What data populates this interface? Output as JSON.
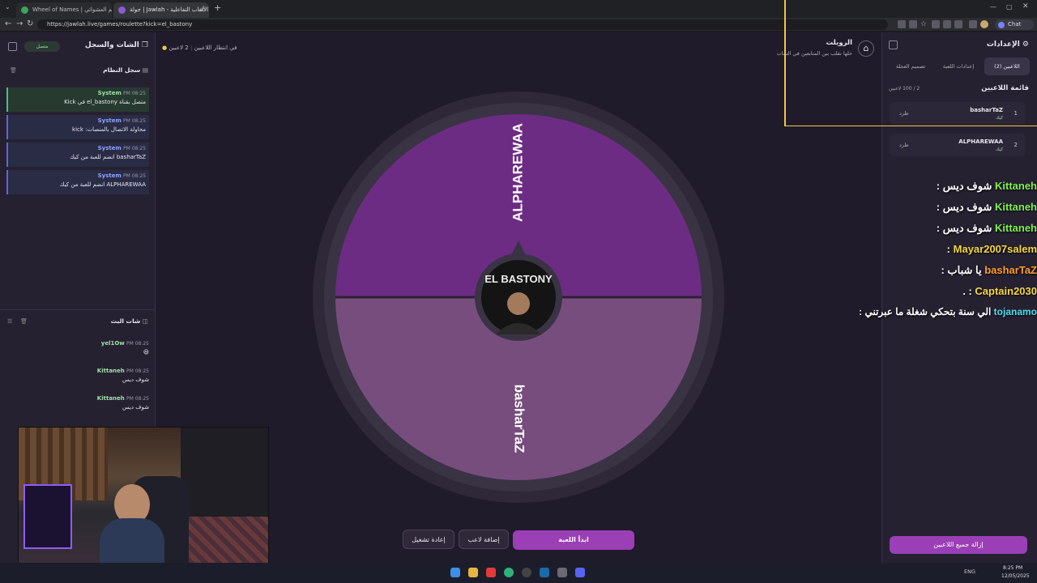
{
  "browser": {
    "tabs": [
      {
        "title": "Wheel of Names | الاسم العشوائي ..."
      },
      {
        "title": "جولة | Jawlah - منصة الألعاب التفاعلية"
      }
    ],
    "url": "https://jawlah.live/games/roulette?kick=el_bastony",
    "chat_button": "Chat"
  },
  "left_panel": {
    "title": "الشات والسجل",
    "status_badge": "متصل",
    "system_log": {
      "title": "سجل النظام",
      "entries": [
        {
          "sender": "System",
          "time": "PM 08:25",
          "message": "متصل بقناة el_bastony في Kick"
        },
        {
          "sender": "System",
          "time": "PM 08:25",
          "message": "محاولة الاتصال بالمنصات: kick"
        },
        {
          "sender": "System",
          "time": "PM 08:25",
          "message": "basharTaZ انضم للعبة من كيك"
        },
        {
          "sender": "System",
          "time": "PM 08:25",
          "message": "ALPHAREWAA انضم للعبة من كيك"
        }
      ]
    },
    "live_chat": {
      "title": "شات البث",
      "messages": [
        {
          "user": "yel1Ow",
          "time": "PM 08:25",
          "message": "😃"
        },
        {
          "user": "Kittaneh",
          "time": "PM 08:25",
          "message": "شوف ديس"
        },
        {
          "user": "Kittaneh",
          "time": "PM 08:25",
          "message": "شوف ديس"
        }
      ]
    }
  },
  "center": {
    "players_count": "2 لاعبين",
    "status": "في انتظار اللاعبين",
    "wheel": {
      "segments": [
        {
          "label": "ALPHAREWAA",
          "color": "#6d2c83"
        },
        {
          "label": "basharTaZ",
          "color": "#774d7e"
        }
      ],
      "center_text": "EL BASTONY"
    },
    "buttons": {
      "start": "ابدأ اللعبة",
      "add_player": "إضافة لاعب",
      "restart": "إعادة تشغيل"
    }
  },
  "game_title": {
    "title": "الرويلت",
    "subtitle": "خلها تقلب بين المتابعين في الشات"
  },
  "right_panel": {
    "title": "الإعدادات",
    "tabs": [
      "اللاعبين (2)",
      "إعدادات اللعبة",
      "تصميم العجلة"
    ],
    "players_header": "قائمة اللاعبين",
    "players_count": "2 / 100 لاعبين",
    "players": [
      {
        "rank": "1",
        "name": "basharTaZ",
        "platform": "كيك",
        "action": "طرد"
      },
      {
        "rank": "2",
        "name": "ALPHAREWAA",
        "platform": "كيك",
        "action": "طرد"
      }
    ],
    "remove_all": "إزالة جميع اللاعبين"
  },
  "stream_chat_overlay": [
    {
      "user": "Kittaneh",
      "message": "شوف ديس :",
      "color": "#7cf24a"
    },
    {
      "user": "Kittaneh",
      "message": "شوف ديس :",
      "color": "#7cf24a"
    },
    {
      "user": "Kittaneh",
      "message": "شوف ديس :",
      "color": "#7cf24a"
    },
    {
      "user": "Mayar2007salem",
      "message": ":",
      "color": "#f5d73b"
    },
    {
      "user": "basharTaZ",
      "message": "يا شباب :",
      "color": "#ff9d2a"
    },
    {
      "user": "Captain2030",
      "message": ": .",
      "color": "#f5d73b"
    },
    {
      "user": "tojanamo",
      "message": "الي سنة بتحكي شغلة ما عبرتني :",
      "color": "#4ae0f5"
    }
  ],
  "taskbar": {
    "time": "8:25 PM",
    "date": "12/05/2025",
    "lang": "ENG"
  }
}
